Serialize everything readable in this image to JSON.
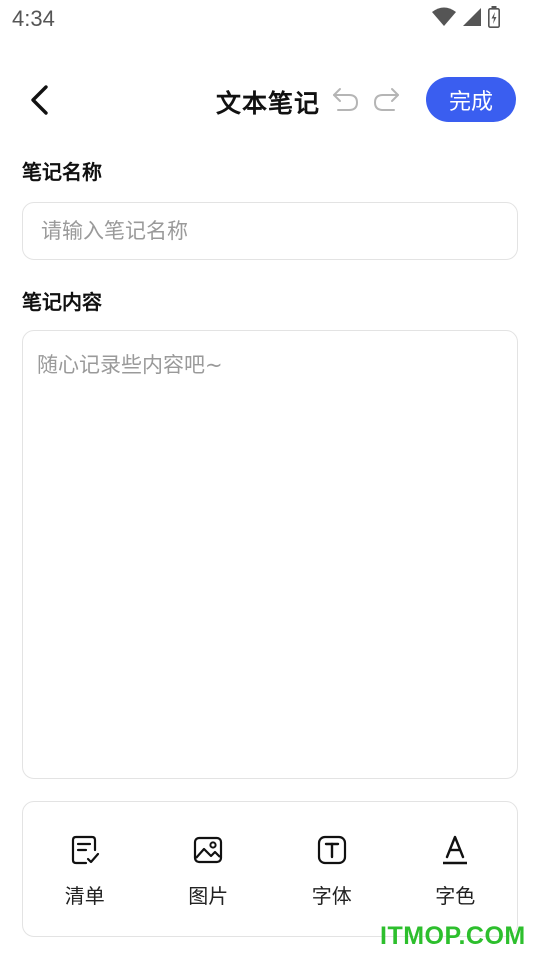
{
  "status_bar": {
    "time": "4:34",
    "icons": [
      "wifi-icon",
      "signal-icon",
      "battery-icon"
    ]
  },
  "header": {
    "title": "文本笔记",
    "done_label": "完成",
    "icons": [
      "back-arrow-icon",
      "undo-icon",
      "redo-icon"
    ]
  },
  "form": {
    "name_label": "笔记名称",
    "name_placeholder": "请输入笔记名称",
    "name_value": "",
    "content_label": "笔记内容",
    "content_placeholder": "随心记录些内容吧~",
    "content_value": ""
  },
  "toolbar": {
    "items": [
      {
        "label": "清单",
        "icon": "checklist-icon"
      },
      {
        "label": "图片",
        "icon": "image-icon"
      },
      {
        "label": "字体",
        "icon": "font-icon"
      },
      {
        "label": "字色",
        "icon": "font-color-icon"
      }
    ]
  },
  "watermark": "ITMOP.COM",
  "colors": {
    "accent": "#3a5ef0",
    "border": "#e3e3e3",
    "placeholder": "#9a9a9a",
    "watermark": "#2dbf2d"
  }
}
